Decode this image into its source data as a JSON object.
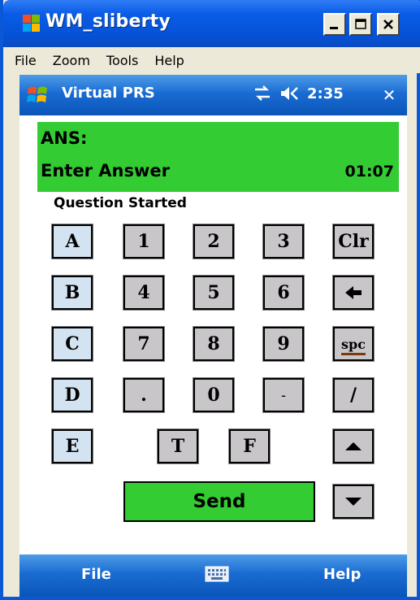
{
  "window": {
    "title": "WM_sliberty",
    "controls": [
      "minimize",
      "maximize",
      "close"
    ]
  },
  "menubar": {
    "items": [
      "File",
      "Zoom",
      "Tools",
      "Help"
    ]
  },
  "device_bar": {
    "title": "Virtual PRS",
    "time": "2:35",
    "close_label": "✕"
  },
  "answer_panel": {
    "label": "ANS:",
    "prompt": "Enter Answer",
    "timer": "01:07",
    "color": "#33cc33"
  },
  "status": "Question Started",
  "keypad": {
    "letters": [
      "A",
      "B",
      "C",
      "D",
      "E"
    ],
    "row1": [
      "1",
      "2",
      "3"
    ],
    "row2": [
      "4",
      "5",
      "6"
    ],
    "row3": [
      "7",
      "8",
      "9"
    ],
    "row4": [
      ".",
      "0",
      "-"
    ],
    "tf": [
      "T",
      "F"
    ],
    "right": [
      "Clr",
      "←",
      "spc",
      "/"
    ],
    "send": "Send"
  },
  "softkeys": {
    "left": "File",
    "right": "Help"
  },
  "icons": {
    "app": "windows-app-icon",
    "start": "windows-start-flag-icon",
    "connectivity": "connectivity-icon",
    "volume": "volume-icon",
    "keyboard": "keyboard-icon",
    "up": "arrow-up-icon",
    "down": "arrow-down-icon"
  }
}
